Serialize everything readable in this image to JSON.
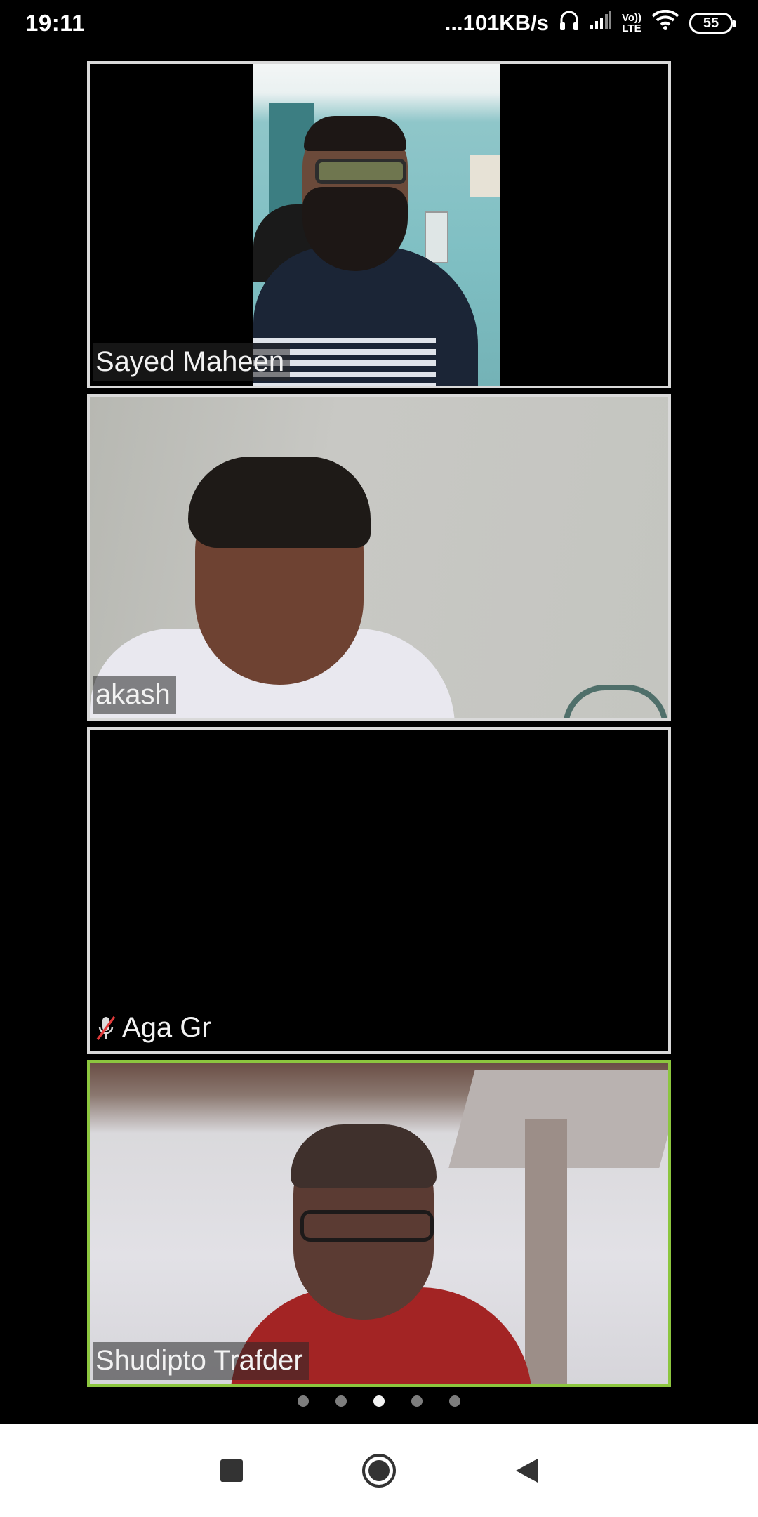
{
  "status_bar": {
    "time": "19:11",
    "net_speed": "...101KB/s",
    "volte_top": "Vo))",
    "volte_bottom": "LTE",
    "battery": "55"
  },
  "participants": [
    {
      "name": "Sayed Maheen",
      "muted": false,
      "active_speaker": false
    },
    {
      "name": "akash",
      "muted": false,
      "active_speaker": false
    },
    {
      "name": "Aga Gr",
      "muted": true,
      "active_speaker": false
    },
    {
      "name": "Shudipto Trafder",
      "muted": false,
      "active_speaker": true
    }
  ],
  "pagination": {
    "total": 5,
    "current": 3
  },
  "nav": {
    "recents": "recents-icon",
    "home": "home-icon",
    "back": "back-icon"
  },
  "colors": {
    "active_border": "#8cc63f",
    "tile_border": "#d9d9d9",
    "background": "#000000"
  }
}
